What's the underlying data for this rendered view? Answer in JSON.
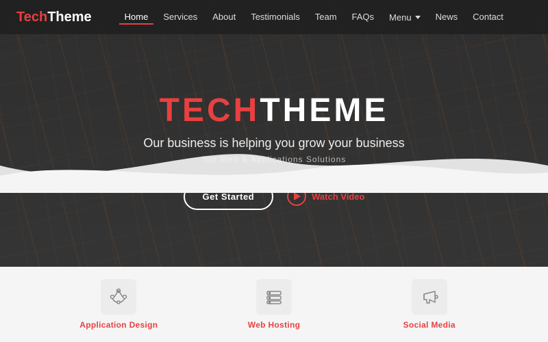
{
  "brand": {
    "name_part1": "Tech",
    "name_part2": "Theme"
  },
  "nav": {
    "links": [
      {
        "label": "Home",
        "active": true
      },
      {
        "label": "Services",
        "active": false
      },
      {
        "label": "About",
        "active": false
      },
      {
        "label": "Testimonials",
        "active": false
      },
      {
        "label": "Team",
        "active": false
      },
      {
        "label": "FAQs",
        "active": false
      },
      {
        "label": "Menu",
        "active": false,
        "hasDropdown": true
      },
      {
        "label": "News",
        "active": false
      },
      {
        "label": "Contact",
        "active": false
      }
    ]
  },
  "hero": {
    "title_part1": "TECH",
    "title_part2": "THEME",
    "subtitle": "Our business is helping you grow your business",
    "tagline": "Top Web & Applications Solutions",
    "btn_start": "Get Started",
    "btn_video": "Watch Video"
  },
  "features": [
    {
      "label": "Application Design"
    },
    {
      "label": "Web Hosting"
    },
    {
      "label": "Social Media"
    }
  ]
}
